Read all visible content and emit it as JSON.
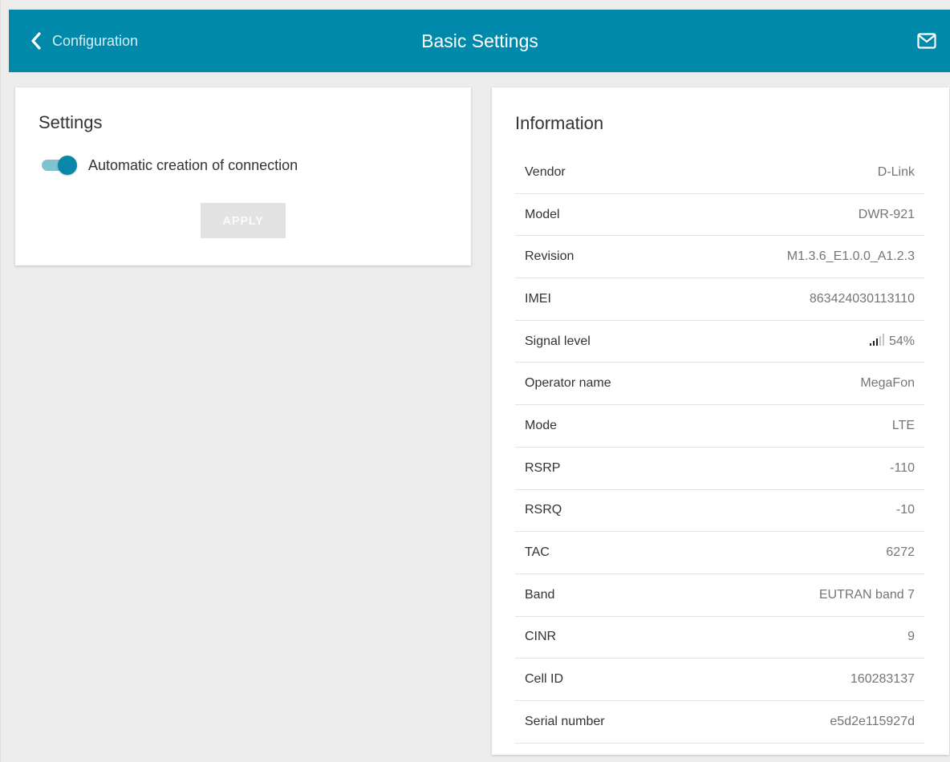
{
  "header": {
    "back_label": "Configuration",
    "title": "Basic Settings",
    "back_icon": "chevron-left-icon",
    "mail_icon": "mail-icon",
    "background_color": "#0089aa"
  },
  "settings": {
    "title": "Settings",
    "auto_connection_label": "Automatic creation of connection",
    "auto_connection_enabled": true,
    "apply_label": "APPLY",
    "apply_enabled": false
  },
  "information": {
    "title": "Information",
    "rows": [
      {
        "label": "Vendor",
        "value": "D-Link"
      },
      {
        "label": "Model",
        "value": "DWR-921"
      },
      {
        "label": "Revision",
        "value": "M1.3.6_E1.0.0_A1.2.3"
      },
      {
        "label": "IMEI",
        "value": "863424030113110"
      },
      {
        "label": "Signal level",
        "value": "54%",
        "signal_bars_active": 3,
        "signal_bars_total": 5
      },
      {
        "label": "Operator name",
        "value": "MegaFon"
      },
      {
        "label": "Mode",
        "value": "LTE"
      },
      {
        "label": "RSRP",
        "value": "-110"
      },
      {
        "label": "RSRQ",
        "value": "-10"
      },
      {
        "label": "TAC",
        "value": "6272"
      },
      {
        "label": "Band",
        "value": "EUTRAN band 7"
      },
      {
        "label": "CINR",
        "value": "9"
      },
      {
        "label": "Cell ID",
        "value": "160283137"
      },
      {
        "label": "Serial number",
        "value": "e5d2e115927d"
      }
    ]
  }
}
